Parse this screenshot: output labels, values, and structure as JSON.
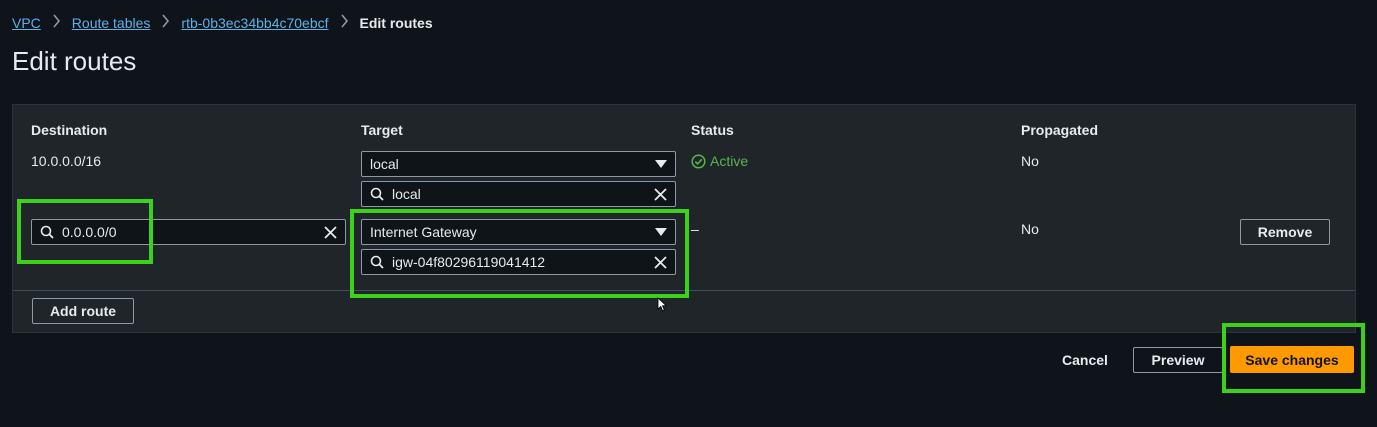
{
  "breadcrumb": {
    "items": [
      "VPC",
      "Route tables",
      "rtb-0b3ec34bb4c70ebcf"
    ],
    "current": "Edit routes"
  },
  "page_title": "Edit routes",
  "table": {
    "headers": {
      "destination": "Destination",
      "target": "Target",
      "status": "Status",
      "propagated": "Propagated"
    },
    "rows": [
      {
        "destination": "10.0.0.0/16",
        "target_select": "local",
        "target_search": "local",
        "status": "Active",
        "propagated": "No"
      },
      {
        "destination_input": "0.0.0.0/0",
        "target_select": "Internet Gateway",
        "target_search": "igw-04f80296119041412",
        "status": "–",
        "propagated": "No",
        "remove_label": "Remove"
      }
    ],
    "add_route_label": "Add route"
  },
  "footer": {
    "cancel_label": "Cancel",
    "preview_label": "Preview",
    "save_label": "Save changes"
  },
  "colors": {
    "background": "#0f141a",
    "panel": "#1f2529",
    "link": "#5fb0e6",
    "primary": "#ff9900",
    "status_active": "#59b54d",
    "highlight": "#3cd11b"
  },
  "icons": {
    "search": "search-icon",
    "clear": "clear-icon",
    "dropdown": "caret-down-icon",
    "chevron": "chevron-right-icon",
    "status": "check-circle-icon",
    "cursor": "mouse-cursor-icon"
  }
}
